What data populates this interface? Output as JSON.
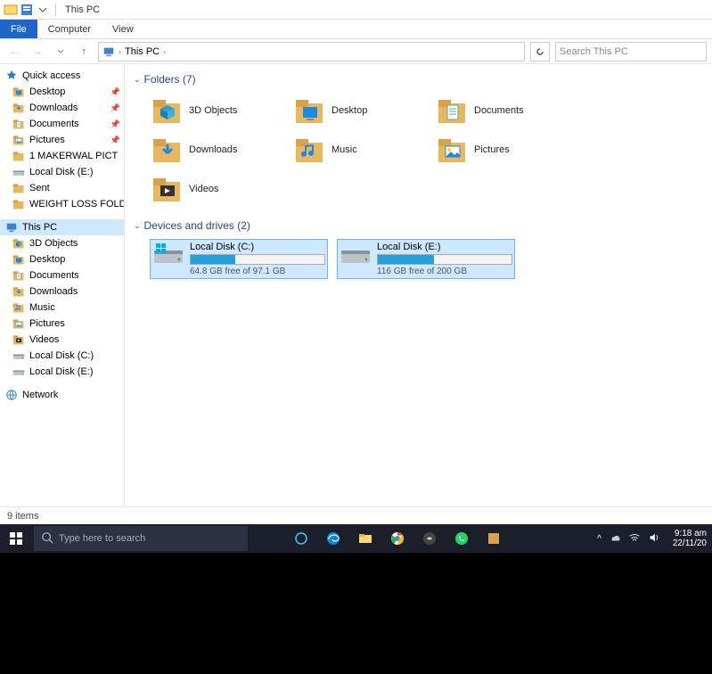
{
  "window": {
    "title": "This PC"
  },
  "ribbon": {
    "file": "File",
    "computer": "Computer",
    "view": "View"
  },
  "nav": {
    "breadcrumb_root": "This PC",
    "breadcrumb_sep": "›",
    "search_placeholder": "Search This PC"
  },
  "sidebar": {
    "quick_access": "Quick access",
    "items_qa": [
      {
        "label": "Desktop",
        "icon": "desktop"
      },
      {
        "label": "Downloads",
        "icon": "downloads"
      },
      {
        "label": "Documents",
        "icon": "documents"
      },
      {
        "label": "Pictures",
        "icon": "pictures"
      },
      {
        "label": "1 MAKERWAL PICT",
        "icon": "folder"
      },
      {
        "label": "Local Disk (E:)",
        "icon": "drive"
      },
      {
        "label": "Sent",
        "icon": "folder"
      },
      {
        "label": "WEIGHT LOSS FOLD",
        "icon": "folder"
      }
    ],
    "this_pc": "This PC",
    "items_pc": [
      {
        "label": "3D Objects",
        "icon": "3d"
      },
      {
        "label": "Desktop",
        "icon": "desktop"
      },
      {
        "label": "Documents",
        "icon": "documents"
      },
      {
        "label": "Downloads",
        "icon": "downloads"
      },
      {
        "label": "Music",
        "icon": "music"
      },
      {
        "label": "Pictures",
        "icon": "pictures"
      },
      {
        "label": "Videos",
        "icon": "videos"
      },
      {
        "label": "Local Disk (C:)",
        "icon": "drive"
      },
      {
        "label": "Local Disk (E:)",
        "icon": "drive"
      }
    ],
    "network": "Network"
  },
  "content": {
    "group_folders": "Folders (7)",
    "folders": [
      {
        "label": "3D Objects",
        "icon": "3d"
      },
      {
        "label": "Desktop",
        "icon": "desktop"
      },
      {
        "label": "Documents",
        "icon": "documents"
      },
      {
        "label": "Downloads",
        "icon": "downloads"
      },
      {
        "label": "Music",
        "icon": "music"
      },
      {
        "label": "Pictures",
        "icon": "pictures"
      },
      {
        "label": "Videos",
        "icon": "videos"
      }
    ],
    "group_drives": "Devices and drives (2)",
    "drives": [
      {
        "name": "Local Disk (C:)",
        "free": "64.8 GB free of 97.1 GB",
        "fill_pct": 33,
        "selected": true,
        "os": true
      },
      {
        "name": "Local Disk (E:)",
        "free": "116 GB free of 200 GB",
        "fill_pct": 42,
        "selected": true,
        "os": false
      }
    ]
  },
  "status": {
    "items": "9 items"
  },
  "taskbar": {
    "search_placeholder": "Type here to search",
    "time": "9:18 am",
    "date": "22/11/20"
  }
}
